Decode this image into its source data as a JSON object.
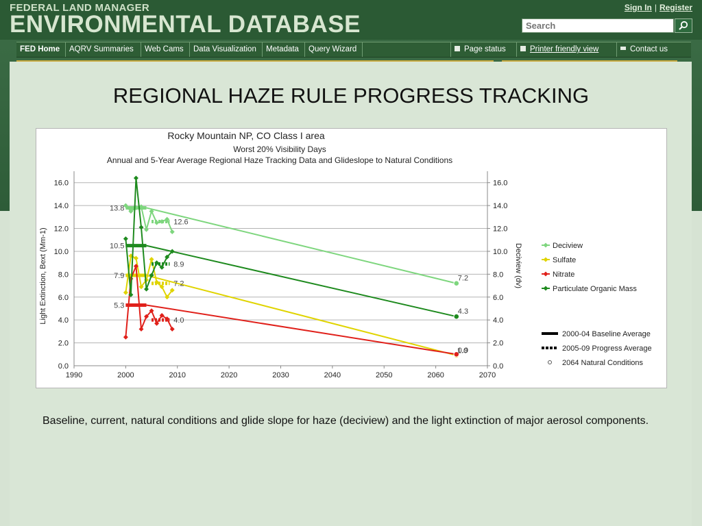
{
  "header": {
    "site_sup": "FEDERAL LAND MANAGER",
    "site_main": "ENVIRONMENTAL DATABASE",
    "sign_in": "Sign In",
    "separator": "|",
    "register": "Register",
    "search_placeholder": "Search"
  },
  "nav": {
    "left": [
      "FED Home",
      "AQRV Summaries",
      "Web Cams",
      "Data Visualization",
      "Metadata",
      "Query Wizard"
    ],
    "right": [
      "Page status",
      "Printer friendly view",
      "Contact us"
    ]
  },
  "slide_title": "REGIONAL HAZE RULE PROGRESS TRACKING",
  "caption": "Baseline, current, natural conditions and glide slope for haze (deciview) and the light extinction of major aerosol components.",
  "colors": {
    "deciview": "#7ed67e",
    "sulfate": "#e0d400",
    "nitrate": "#e0201a",
    "organic": "#1e8a1e",
    "header_green": "#2b5a34",
    "accent_gold": "#c7a93f"
  },
  "chart_data": {
    "type": "line",
    "title": "Rocky Mountain NP, CO Class I area",
    "subtitle1": "Worst 20% Visibility Days",
    "subtitle2": "Annual and 5-Year Average Regional Haze Tracking Data and Glideslope to Natural Conditions",
    "ylabel": "Light Extinction, Bext (Mm-1)",
    "y2label": "Deciview (dv)",
    "xlim": [
      1990,
      2070
    ],
    "ylim": [
      0,
      17
    ],
    "xticks": [
      "1990",
      "2000",
      "2010",
      "2020",
      "2030",
      "2040",
      "2050",
      "2060",
      "2070"
    ],
    "yticks": [
      "0.0",
      "2.0",
      "4.0",
      "6.0",
      "8.0",
      "10.0",
      "12.0",
      "14.0",
      "16.0"
    ],
    "grid": "horizontal",
    "legend_position": "right",
    "series": [
      {
        "name": "Deciview",
        "color_key": "deciview",
        "x": [
          2000,
          2001,
          2002,
          2003,
          2004,
          2005,
          2006,
          2007,
          2008,
          2009
        ],
        "y": [
          14.0,
          13.5,
          13.8,
          13.9,
          11.9,
          13.5,
          12.5,
          12.6,
          12.8,
          11.7
        ],
        "baseline": 13.8,
        "progress": 12.6,
        "glide_end": 7.2,
        "labels": {
          "baseline": "13.8",
          "progress": "12.6",
          "natural": "7.2"
        }
      },
      {
        "name": "Sulfate",
        "color_key": "sulfate",
        "x": [
          2000,
          2001,
          2002,
          2003,
          2004,
          2005,
          2006,
          2007,
          2008,
          2009
        ],
        "y": [
          6.4,
          9.6,
          9.4,
          6.9,
          7.5,
          9.3,
          7.3,
          6.9,
          6.0,
          6.6
        ],
        "baseline": 7.9,
        "progress": 7.2,
        "glide_end": 0.9,
        "labels": {
          "baseline": "7.9",
          "progress": "7.2",
          "natural": "0.9"
        }
      },
      {
        "name": "Nitrate",
        "color_key": "nitrate",
        "x": [
          2000,
          2001,
          2002,
          2003,
          2004,
          2005,
          2006,
          2007,
          2008,
          2009
        ],
        "y": [
          2.5,
          7.6,
          8.7,
          3.2,
          4.3,
          4.8,
          3.7,
          4.4,
          4.1,
          3.2
        ],
        "baseline": 5.3,
        "progress": 4.0,
        "glide_end": 1.0,
        "labels": {
          "baseline": "5.3",
          "progress": "4.0",
          "natural": "1.0"
        }
      },
      {
        "name": "Particulate Organic Mass",
        "color_key": "organic",
        "x": [
          2000,
          2001,
          2002,
          2003,
          2004,
          2005,
          2006,
          2007,
          2008,
          2009
        ],
        "y": [
          11.1,
          6.2,
          16.4,
          12.1,
          6.7,
          7.9,
          9.0,
          8.6,
          9.5,
          10.0
        ],
        "baseline": 10.5,
        "progress": 8.9,
        "glide_end": 4.3,
        "labels": {
          "baseline": "10.5",
          "progress": "8.9",
          "natural": "4.3"
        }
      }
    ],
    "baseline_period": [
      2000,
      2004
    ],
    "progress_period": [
      2005,
      2009
    ],
    "glide_start_year": 2004,
    "natural_year": 2064,
    "legend_extra": [
      "2000-04 Baseline Average",
      "2005-09 Progress Average",
      "2064 Natural Conditions"
    ]
  }
}
